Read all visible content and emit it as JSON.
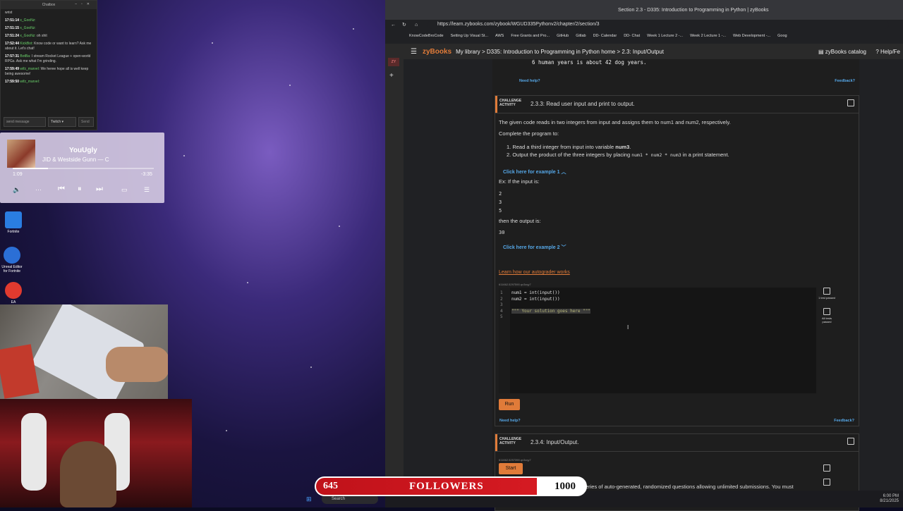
{
  "chat": {
    "title": "Chatbox",
    "top_text": "wrist",
    "lines": [
      {
        "time": "17:51:14",
        "name": "x_GooNz:",
        "text": ""
      },
      {
        "time": "17:51:15",
        "name": "x_GooNz:",
        "text": ""
      },
      {
        "time": "17:51:24",
        "name": "x_GooNz:",
        "text": "oh shit"
      },
      {
        "time": "17:52:44",
        "name": "KickBot:",
        "text": "Know code or want to learn? Ask me about it. Let's chat!"
      },
      {
        "time": "17:57:31",
        "name": "BotBa:",
        "text": "I stream Rocket League + open-world RPGs. Ask me what I'm grinding."
      },
      {
        "time": "17:59:49",
        "name": "wifz_marvel:",
        "text": "We heree hope all is well keep being awesome!"
      },
      {
        "time": "17:59:50",
        "name": "wifz_marvel:",
        "text": ""
      }
    ],
    "input_placeholder": "send message",
    "platform": "Twitch",
    "send_label": "Send"
  },
  "music": {
    "title": "YouUgly",
    "artist": "JID & Westside Gunn — C",
    "elapsed": "1:09",
    "remaining": "-3:35",
    "progress": 0.25
  },
  "desktop_icons": [
    {
      "label": "Fortnite"
    },
    {
      "label": "Unreal Editor for Fortnite"
    },
    {
      "label": "EA"
    }
  ],
  "browser": {
    "window_title": "Section 2.3 - D335: Introduction to Programming in Python | zyBooks",
    "url": "https://learn.zybooks.com/zybook/WGUD335Pythonv2/chapter/2/section/3",
    "bookmarks": [
      "KnowCodeBroCode",
      "Setting Up Visual St...",
      "AWS",
      "Free Grants and Pro...",
      "GitHub",
      "Gitlab",
      "DD- Calendar",
      "DD- Chat",
      "Week 1 Lecture 2 -...",
      "Week 2 Lecture 1 -...",
      "Web Development -...",
      "Goog"
    ]
  },
  "zy": {
    "logo": "zyBooks",
    "breadcrumb": "My library > D335: Introduction to Programming in Python home > 2.3: Input/Output",
    "catalog": "zyBooks catalog",
    "help": "Help/Fe",
    "sidebar_badge": "ZY",
    "prev_output": "6 human years is about 42 dog years.",
    "need_help": "Need help?",
    "feedback": "Feedback?",
    "challenge_label_1": "CHALLENGE",
    "challenge_label_2": "ACTIVITY",
    "act1_title": "2.3.3: Read user input and print to output.",
    "act1_desc": "The given code reads in two integers from input and assigns them to num1 and num2, respectively.",
    "act1_complete": "Complete the program to:",
    "step1_pre": "Read a third integer from input into variable ",
    "step1_var": "num3",
    "step2_pre": "Output the product of the three integers by placing ",
    "step2_code": "num1 * num2 * num3",
    "step2_post": " in a print statement.",
    "ex1_link": "Click here for example 1",
    "ex_input_label": "Ex: If the input is:",
    "ex_inputs": [
      "2",
      "3",
      "5"
    ],
    "ex_output_label": "then the output is:",
    "ex_output": "30",
    "ex2_link": "Click here for example 2",
    "autograder_link": "Learn how our autograder works",
    "code_id": "611662.5297590.qx3zqy7",
    "code_lines": [
      "num1 = int(input())",
      "num2 = int(input())",
      "",
      "\"\"\" Your solution goes here \"\"\"",
      ""
    ],
    "test1_label": "1 test passed",
    "test2_label": "All tests passed",
    "run_label": "Run",
    "act2_title": "2.3.4: Input/Output.",
    "act2_code_id": "611662.5297390.qx3zqy7",
    "start_label": "Start",
    "act2_desc": "This challenge activity consists of a series of auto-generated, randomized questions allowing unlimited submissions. You must"
  },
  "overlay": {
    "count": "645",
    "label": "FOLLOWERS",
    "goal": "1000",
    "progress": 0.645
  },
  "taskbar": {
    "search": "Search",
    "time": "6:00 PM",
    "date": "8/21/2025"
  }
}
